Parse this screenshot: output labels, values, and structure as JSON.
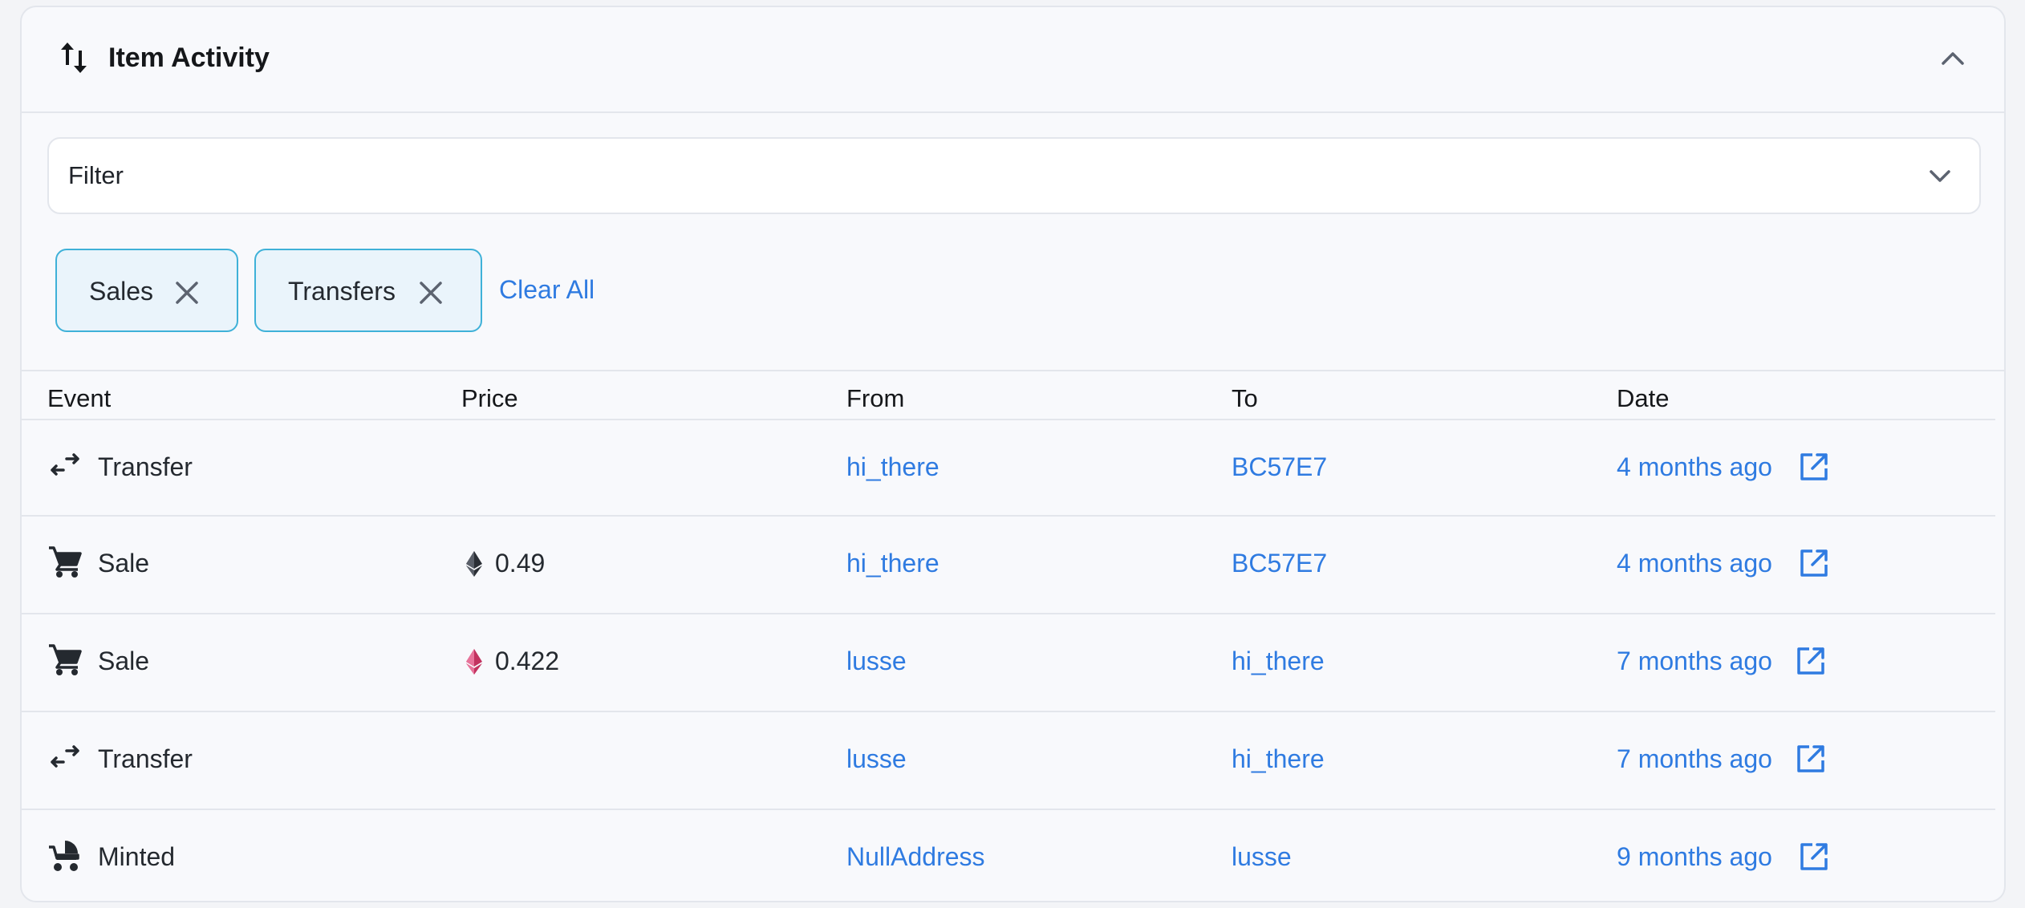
{
  "header": {
    "title": "Item Activity",
    "icon": "arrows-up-down-icon",
    "collapse_icon": "chevron-up-icon"
  },
  "filter": {
    "label": "Filter",
    "icon": "chevron-down-icon"
  },
  "chips": [
    {
      "label": "Sales"
    },
    {
      "label": "Transfers"
    }
  ],
  "clear_all": "Clear All",
  "columns": [
    "Event",
    "Price",
    "From",
    "To",
    "Date"
  ],
  "rows": [
    {
      "event": "Transfer",
      "icon": "transfer-icon",
      "price": "",
      "price_icon": "",
      "from": "hi_there",
      "to": "BC57E7",
      "date": "4 months ago"
    },
    {
      "event": "Sale",
      "icon": "cart-icon",
      "price": "0.49",
      "price_icon": "eth-icon",
      "from": "hi_there",
      "to": "BC57E7",
      "date": "4 months ago"
    },
    {
      "event": "Sale",
      "icon": "cart-icon",
      "price": "0.422",
      "price_icon": "weth-icon",
      "from": "lusse",
      "to": "hi_there",
      "date": "7 months ago"
    },
    {
      "event": "Transfer",
      "icon": "transfer-icon",
      "price": "",
      "price_icon": "",
      "from": "lusse",
      "to": "hi_there",
      "date": "7 months ago"
    },
    {
      "event": "Minted",
      "icon": "stroller-icon",
      "price": "",
      "price_icon": "",
      "from": "NullAddress",
      "to": "lusse",
      "date": "9 months ago"
    }
  ],
  "colors": {
    "link": "#2f7be1",
    "chip_border": "#3fb1d8",
    "chip_bg": "#eaf4fb",
    "weth": "#d8457b"
  }
}
